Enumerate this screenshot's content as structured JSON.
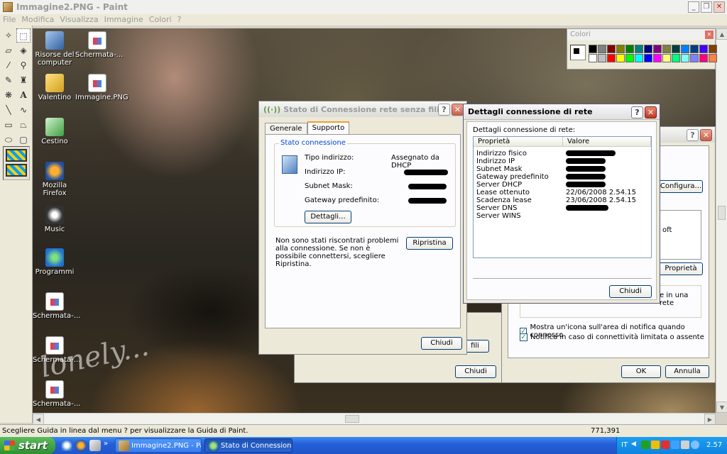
{
  "paint": {
    "title": "Immagine2.PNG - Paint",
    "menu": [
      "File",
      "Modifica",
      "Visualizza",
      "Immagine",
      "Colori",
      "?"
    ],
    "status": "Scegliere Guida in linea dal menu ? per visualizzare la Guida di Paint.",
    "coords": "771,391"
  },
  "palette": {
    "title": "Colori",
    "colors": [
      "#000000",
      "#808080",
      "#800000",
      "#808000",
      "#008000",
      "#008080",
      "#000080",
      "#800080",
      "#808040",
      "#004040",
      "#0080ff",
      "#004080",
      "#4000ff",
      "#804000",
      "#ffffff",
      "#c0c0c0",
      "#ff0000",
      "#ffff00",
      "#00ff00",
      "#00ffff",
      "#0000ff",
      "#ff00ff",
      "#ffff80",
      "#00ff80",
      "#80ffff",
      "#8080ff",
      "#ff0080",
      "#ff8040"
    ]
  },
  "desktop_icons": [
    "Risorse del computer",
    "Schermata-...",
    "Valentino",
    "Immagine.PNG",
    "Cestino",
    "Mozilla Firefox",
    "Music",
    "Programmi",
    "Schermata-...",
    "Schermata-...",
    "Schermata-..."
  ],
  "dlg_status": {
    "title": "Stato di Connessione rete senza fili",
    "tabs": [
      "Generale",
      "Supporto"
    ],
    "group_title": "Stato connessione",
    "lbl_address_type": "Tipo indirizzo:",
    "val_address_type": "Assegnato da DHCP",
    "lbl_ip": "Indirizzo IP:",
    "lbl_mask": "Subnet Mask:",
    "lbl_gateway": "Gateway predefinito:",
    "details_btn": "Dettagli...",
    "message": "Non sono stati riscontrati problemi alla connessione. Se non è possibile connettersi, scegliere Ripristina.",
    "repair_btn": "Ripristina",
    "close_btn": "Chiudi"
  },
  "dlg_details": {
    "title": "Dettagli connessione di rete",
    "label": "Dettagli connessione di rete:",
    "col_prop": "Proprietà",
    "col_val": "Valore",
    "rows": [
      {
        "prop": "Indirizzo fisico",
        "val": ""
      },
      {
        "prop": "Indirizzo IP",
        "val": ""
      },
      {
        "prop": "Subnet Mask",
        "val": ""
      },
      {
        "prop": "Gateway predefinito",
        "val": ""
      },
      {
        "prop": "Server DHCP",
        "val": ""
      },
      {
        "prop": "Lease ottenuto",
        "val": "22/06/2008 2.54.15"
      },
      {
        "prop": "Scadenza lease",
        "val": "23/06/2008 2.54.15"
      },
      {
        "prop": "Server DNS",
        "val": ""
      },
      {
        "prop": "Server WINS",
        "val": ""
      }
    ],
    "close_btn": "Chiudi"
  },
  "dlg_props": {
    "configure_btn": "Configura...",
    "partial_text_1": "oft",
    "properties_btn": "Proprietà",
    "partial_text_2": "e in una rete",
    "chk_notify_icon": "Mostra un'icona sull'area di notifica quando connesso",
    "chk_limited": "Notifica in caso di connettività limitata o assente",
    "ok_btn": "OK",
    "cancel_btn": "Annulla"
  },
  "dlg_back": {
    "partial_btn": "fili",
    "close_btn": "Chiudi"
  },
  "taskbar": {
    "start": "start",
    "tasks": [
      "Immagine2.PNG - Paint",
      "Stato di Connessione ..."
    ],
    "lang": "IT",
    "clock": "2.57"
  }
}
